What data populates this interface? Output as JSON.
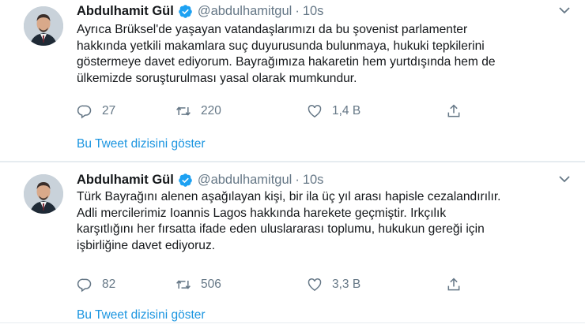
{
  "tweets": [
    {
      "name": "Abdulhamit Gül",
      "handle": "@abdulhamitgul",
      "separator": "·",
      "time": "10s",
      "lines": [
        "Ayrıca Brüksel'de yaşayan vatandaşlarımızı da bu şovenist parlamenter",
        "hakkında yetkili makamlara suç duyurusunda bulunmaya, hukuki tepkilerini",
        "göstermeye davet ediyorum. Bayrağımıza hakaretin hem yurtdışında hem de",
        "ülkemizde soruşturulması yasal olarak mumkundur."
      ],
      "replies": "27",
      "retweets": "220",
      "likes": "1,4 B",
      "thread_link": "Bu Tweet dizisini göster"
    },
    {
      "name": "Abdulhamit Gül",
      "handle": "@abdulhamitgul",
      "separator": "·",
      "time": "10s",
      "lines": [
        "Türk Bayrağını alenen aşağılayan kişi, bir ila üç yıl arası hapisle cezalandırılır.",
        "Adli mercilerimiz Ioannis Lagos hakkında harekete geçmiştir. Irkçılık",
        "karşıtlığını her fırsatta ifade eden uluslararası toplumu, hukukun gereği için",
        "işbirliğine davet ediyoruz."
      ],
      "replies": "82",
      "retweets": "506",
      "likes": "3,3 B",
      "thread_link": "Bu Tweet dizisini göster"
    }
  ],
  "colors": {
    "accent": "#1da1f2",
    "link": "#1b95e0",
    "muted": "#657786"
  },
  "icons": [
    "avatar",
    "verified-badge-icon",
    "chevron-down-icon",
    "reply-icon",
    "retweet-icon",
    "like-icon",
    "share-icon"
  ]
}
